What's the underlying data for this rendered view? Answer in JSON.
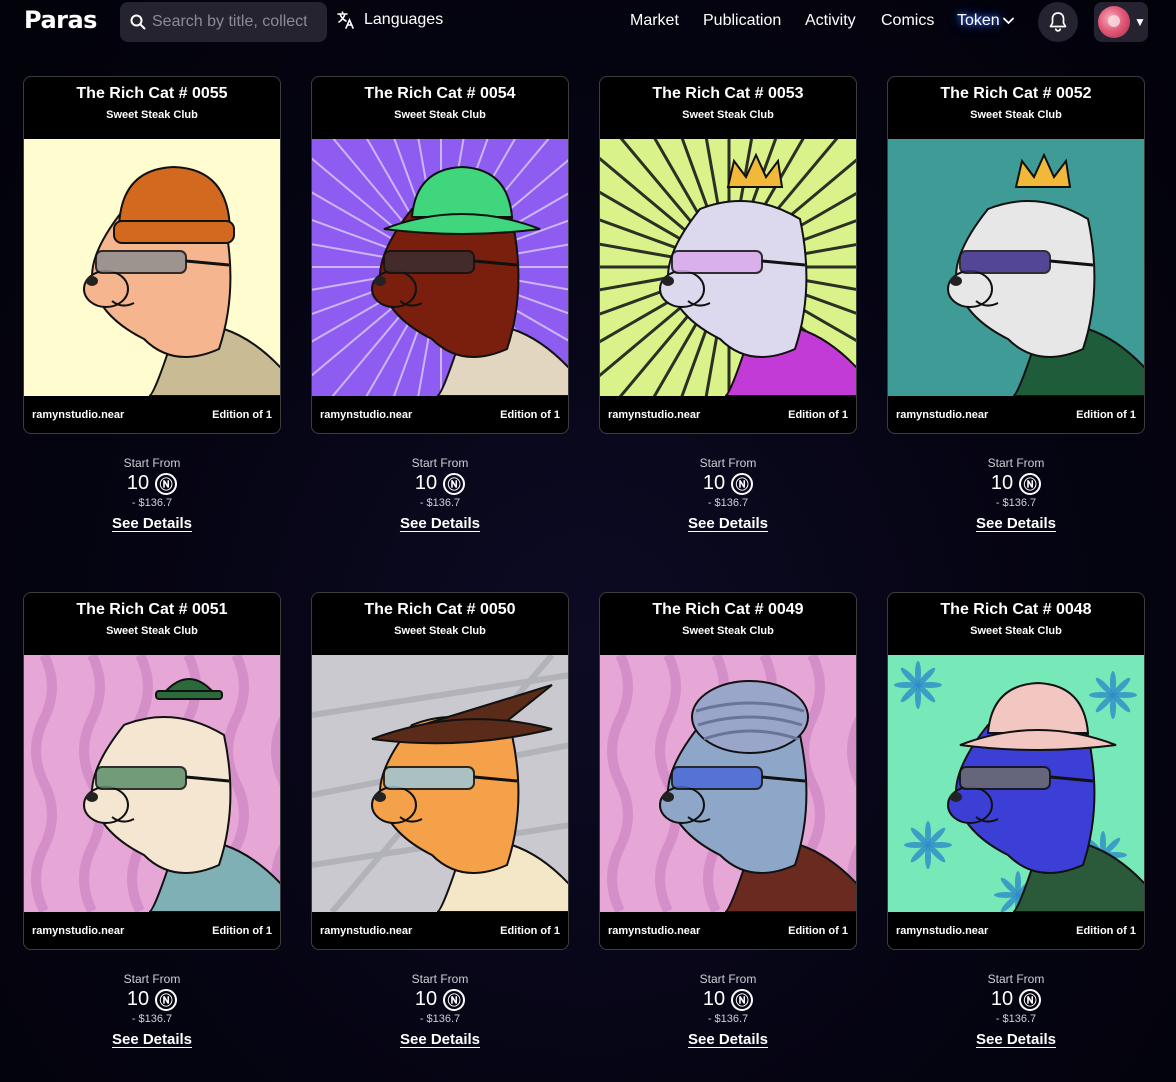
{
  "header": {
    "logo": "Paras",
    "search_placeholder": "Search by title, collection or artist",
    "languages_label": "Languages",
    "menu": [
      "Market",
      "Publication",
      "Activity",
      "Comics"
    ],
    "token_label": "Token"
  },
  "cards": [
    {
      "title": "The Rich Cat # 0055",
      "collection": "Sweet Steak Club",
      "creator": "ramynstudio.near",
      "edition": "Edition of 1",
      "start_from": "Start From",
      "price": "10",
      "currency_symbol": "Ⓝ",
      "usd": "- $136.7",
      "details": "See Details"
    },
    {
      "title": "The Rich Cat # 0054",
      "collection": "Sweet Steak Club",
      "creator": "ramynstudio.near",
      "edition": "Edition of 1",
      "start_from": "Start From",
      "price": "10",
      "currency_symbol": "Ⓝ",
      "usd": "- $136.7",
      "details": "See Details"
    },
    {
      "title": "The Rich Cat # 0053",
      "collection": "Sweet Steak Club",
      "creator": "ramynstudio.near",
      "edition": "Edition of 1",
      "start_from": "Start From",
      "price": "10",
      "currency_symbol": "Ⓝ",
      "usd": "- $136.7",
      "details": "See Details"
    },
    {
      "title": "The Rich Cat # 0052",
      "collection": "Sweet Steak Club",
      "creator": "ramynstudio.near",
      "edition": "Edition of 1",
      "start_from": "Start From",
      "price": "10",
      "currency_symbol": "Ⓝ",
      "usd": "- $136.7",
      "details": "See Details"
    },
    {
      "title": "The Rich Cat # 0051",
      "collection": "Sweet Steak Club",
      "creator": "ramynstudio.near",
      "edition": "Edition of 1",
      "start_from": "Start From",
      "price": "10",
      "currency_symbol": "Ⓝ",
      "usd": "- $136.7",
      "details": "See Details"
    },
    {
      "title": "The Rich Cat # 0050",
      "collection": "Sweet Steak Club",
      "creator": "ramynstudio.near",
      "edition": "Edition of 1",
      "start_from": "Start From",
      "price": "10",
      "currency_symbol": "Ⓝ",
      "usd": "- $136.7",
      "details": "See Details"
    },
    {
      "title": "The Rich Cat # 0049",
      "collection": "Sweet Steak Club",
      "creator": "ramynstudio.near",
      "edition": "Edition of 1",
      "start_from": "Start From",
      "price": "10",
      "currency_symbol": "Ⓝ",
      "usd": "- $136.7",
      "details": "See Details"
    },
    {
      "title": "The Rich Cat # 0048",
      "collection": "Sweet Steak Club",
      "creator": "ramynstudio.near",
      "edition": "Edition of 1",
      "start_from": "Start From",
      "price": "10",
      "currency_symbol": "Ⓝ",
      "usd": "- $136.7",
      "details": "See Details"
    }
  ],
  "artwork": [
    {
      "background": "#fffdd0",
      "fur": "#f4b58f",
      "hat": "#d2691e",
      "hat_style": "beanie",
      "shirt": "#c9bc95",
      "eyewear": "#8f8f8f"
    },
    {
      "background": "#8e5cf0",
      "fur": "#7a1e0d",
      "hat": "#3fd67e",
      "hat_style": "bucket",
      "shirt": "#e3d6c0",
      "eyewear": "#3a2e2e"
    },
    {
      "background": "#d9f28a",
      "fur": "#dcd8ee",
      "hat": "#f2b83a",
      "hat_style": "crown",
      "shirt": "#c23bd6",
      "eyewear": "#d9a8ec"
    },
    {
      "background": "#3f9b95",
      "fur": "#e7e7e7",
      "hat": "#f2b83a",
      "hat_style": "crown",
      "shirt": "#1f5d3a",
      "eyewear": "#3b2a8a"
    },
    {
      "background": "#e6a6d6",
      "fur": "#f5e6d2",
      "hat": "#2b6a3a",
      "hat_style": "bowler",
      "shirt": "#7fb0b5",
      "eyewear": "#5a8f6a"
    },
    {
      "background": "#c9c9cf",
      "fur": "#f4a14a",
      "hat": "#5a2b18",
      "hat_style": "witch",
      "shirt": "#f3e7c7",
      "eyewear": "#9fc6d6"
    },
    {
      "background": "#e6a6d6",
      "fur": "#8ea7c9",
      "hat": "#9aa6c9",
      "hat_style": "turban",
      "shirt": "#6b2a20",
      "eyewear": "#4a6ad6"
    },
    {
      "background": "#77e9b9",
      "fur": "#3b3fd6",
      "hat": "#f2c7c2",
      "hat_style": "bucket",
      "shirt": "#2b5a3a",
      "eyewear": "#6d6d6d"
    }
  ]
}
